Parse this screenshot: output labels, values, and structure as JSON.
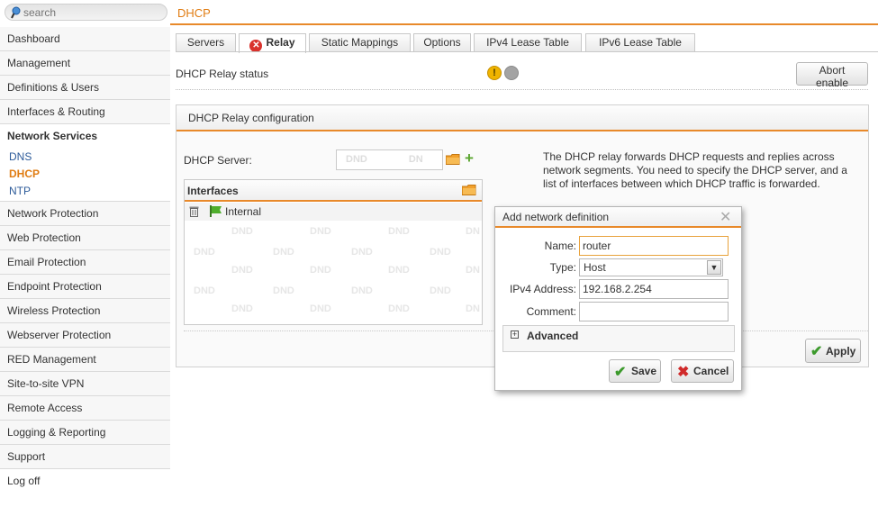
{
  "search": {
    "placeholder": "search"
  },
  "sidebar": {
    "items_top": [
      "Dashboard",
      "Management",
      "Definitions & Users",
      "Interfaces & Routing"
    ],
    "section": "Network Services",
    "sub_items": [
      "DNS",
      "DHCP",
      "NTP"
    ],
    "items_bottom": [
      "Network Protection",
      "Web Protection",
      "Email Protection",
      "Endpoint Protection",
      "Wireless Protection",
      "Webserver Protection",
      "RED Management",
      "Site-to-site VPN",
      "Remote Access",
      "Logging & Reporting",
      "Support",
      "Log off"
    ]
  },
  "header": {
    "title": "DHCP"
  },
  "tabs": [
    "Servers",
    "Relay",
    "Static Mappings",
    "Options",
    "IPv4 Lease Table",
    "IPv6 Lease Table"
  ],
  "status": {
    "label": "DHCP Relay status",
    "button": "Abort enable"
  },
  "config": {
    "title": "DHCP Relay configuration",
    "server_label": "DHCP Server:",
    "server_dnd": "DND",
    "server_dnd2": "DN",
    "help": "The DHCP relay forwards DHCP requests and replies across network segments. You need to specify the DHCP server, and a list of interfaces between which DHCP traffic is forwarded.",
    "interfaces_title": "Interfaces",
    "interface_entry": "Internal",
    "dnd_text": "DND",
    "dnd_short": "DN",
    "apply": "Apply"
  },
  "dialog": {
    "title": "Add network definition",
    "name_label": "Name:",
    "name_value": "router",
    "type_label": "Type:",
    "type_value": "Host",
    "ipv4_label": "IPv4 Address:",
    "ipv4_value": "192.168.2.254",
    "comment_label": "Comment:",
    "comment_value": "",
    "advanced": "Advanced",
    "save": "Save",
    "cancel": "Cancel"
  },
  "colors": {
    "accent": "#e8892a",
    "link": "#2c5a99",
    "active": "#e07c12"
  }
}
